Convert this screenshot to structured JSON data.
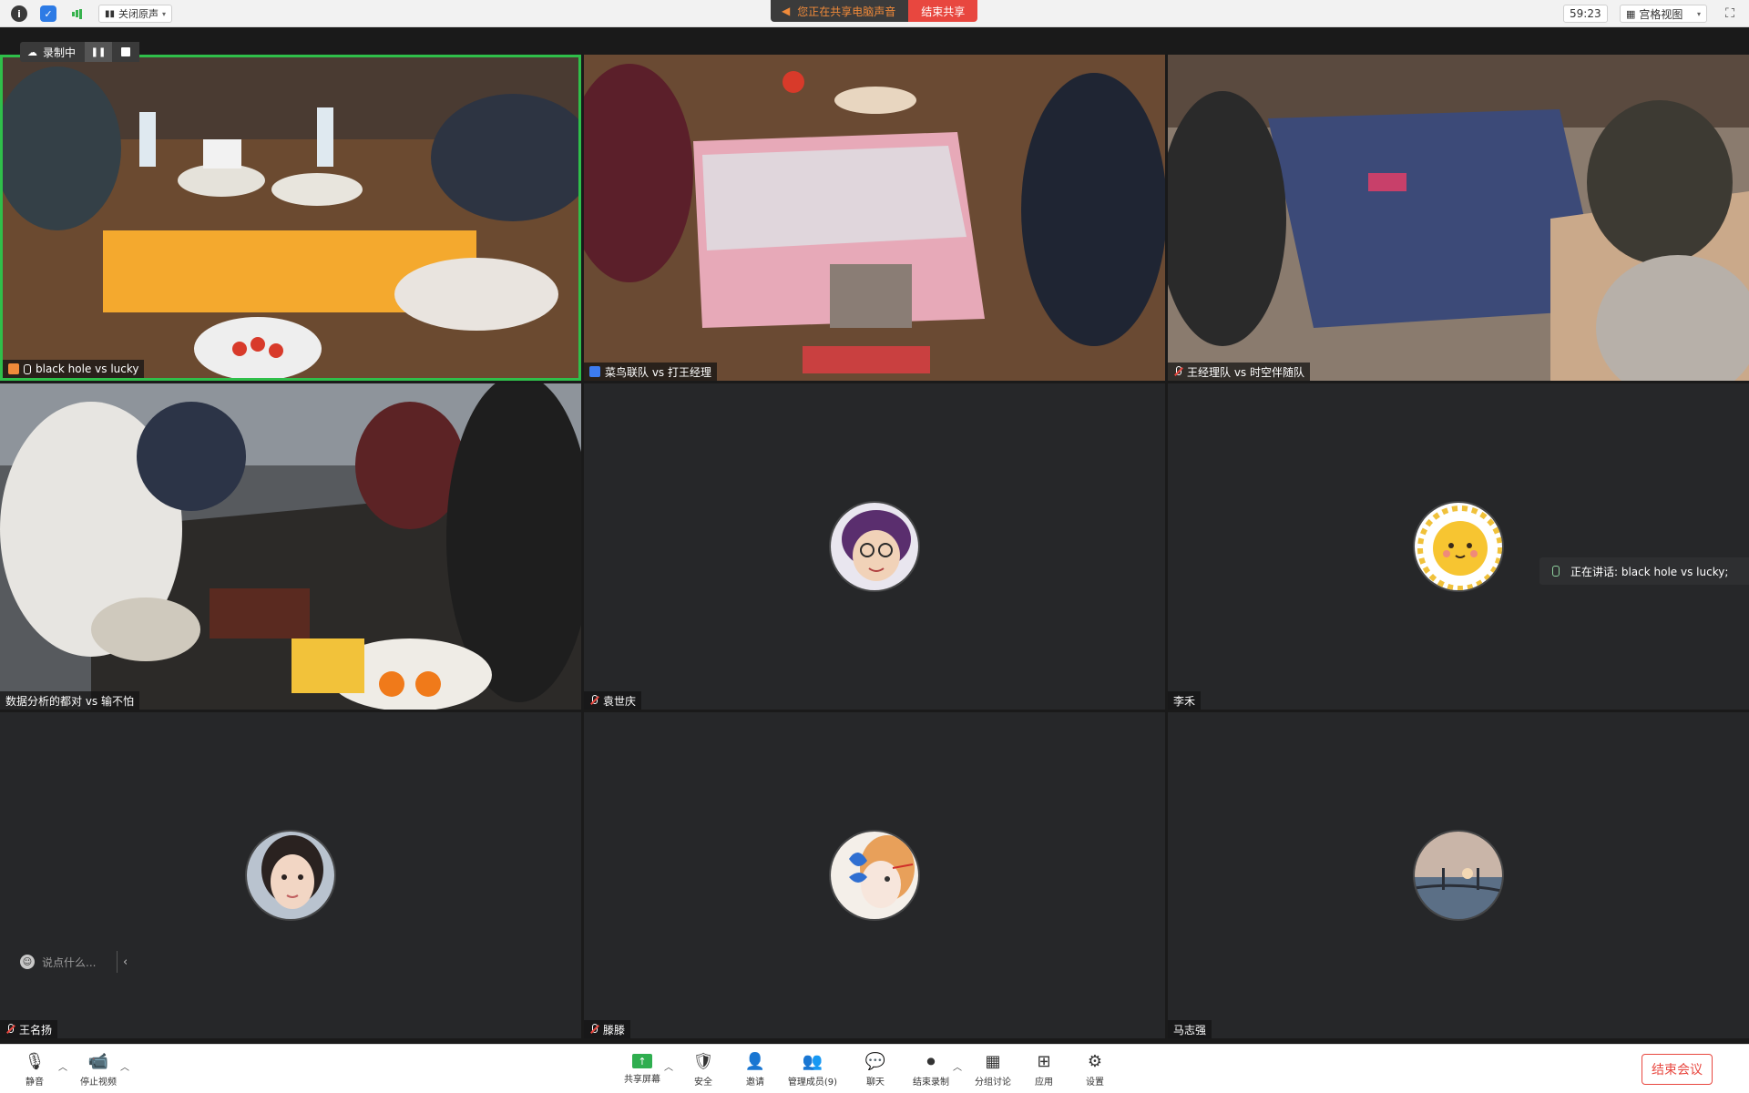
{
  "topbar": {
    "audio_label": "关闭原声",
    "share_message": "您正在共享电脑声音",
    "end_share_label": "结束共享",
    "timer": "59:23",
    "view_label": "宫格视图"
  },
  "recording": {
    "label": "录制中"
  },
  "tiles": [
    {
      "name": "black hole vs lucky",
      "type": "video",
      "active": true
    },
    {
      "name": "菜鸟联队 vs 打王经理",
      "type": "video"
    },
    {
      "name": "王经理队 vs 时空伴随队",
      "type": "video"
    },
    {
      "name": "数据分析的都对 vs 输不怕",
      "type": "video"
    },
    {
      "name": "袁世庆",
      "type": "avatar"
    },
    {
      "name": "李禾",
      "type": "avatar"
    },
    {
      "name": "王名扬",
      "type": "avatar"
    },
    {
      "name": "滕滕",
      "type": "avatar"
    },
    {
      "name": "马志强",
      "type": "avatar"
    }
  ],
  "speaking_notice": "正在讲话: black hole vs lucky;",
  "chat": {
    "placeholder": "说点什么..."
  },
  "toolbar": {
    "mute": "静音",
    "stop_video": "停止视频",
    "share_screen": "共享屏幕",
    "security": "安全",
    "invite": "邀请",
    "participants": "管理成员(9)",
    "chat": "聊天",
    "end_recording": "结束录制",
    "breakout": "分组讨论",
    "apps": "应用",
    "settings": "设置",
    "end_meeting": "结束会议"
  },
  "colors": {
    "active_speaker_border": "#2fbf4a",
    "end_red": "#e8473f",
    "tile_bg": "#262729"
  }
}
